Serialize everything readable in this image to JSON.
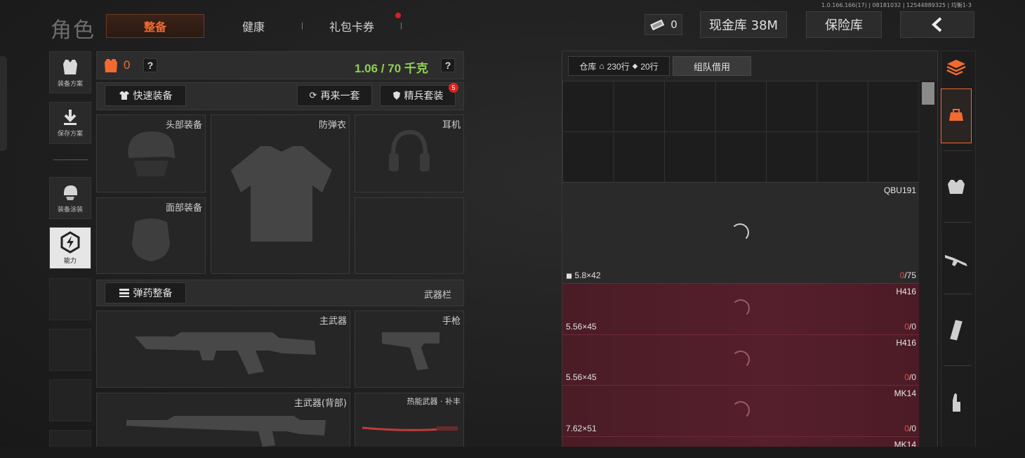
{
  "version": "1.0.166.166(17) | 08181032 | 12544889325 | 均衡1-3",
  "header": {
    "title": "角色",
    "tabs": [
      {
        "label": "整备",
        "active": true
      },
      {
        "label": "健康",
        "active": false
      },
      {
        "label": "礼包卡券",
        "active": false,
        "badge": true
      }
    ],
    "ticket_count": "0",
    "cash_label": "现金库 38M",
    "safe_label": "保险库",
    "back_icon": "chevron-left-icon"
  },
  "side_menu": [
    {
      "label": "装备方案",
      "icon": "vest-icon"
    },
    {
      "label": "保存方案",
      "icon": "download-icon"
    },
    {
      "label": "装备涂装",
      "icon": "helmet-paint-icon"
    },
    {
      "label": "能力",
      "icon": "ability-icon",
      "active": true
    }
  ],
  "equipment": {
    "armor_value": "0",
    "help_mark": "?",
    "weight": "1.06 / 70 千克",
    "quick_equip": "快速装备",
    "again_set": "再来一套",
    "elite_set": "精兵套装",
    "elite_badge": "5",
    "slots": {
      "head": "头部装备",
      "vest": "防弹衣",
      "headset": "耳机",
      "face": "面部装备"
    },
    "ammo_arrange": "弹药整备",
    "weapon_bar": "武器栏",
    "weapons": {
      "primary": "主武器",
      "pistol": "手枪",
      "primary_back": "主武器(背部)",
      "melee": "热能武器 · 补丰"
    }
  },
  "warehouse": {
    "tab_label": "仓库",
    "rows_a": "230行",
    "rows_b": "20行",
    "team_borrow": "组队借用",
    "items": [
      {
        "name": "QBU191",
        "caliber": "5.8×42",
        "count_cur": "0",
        "count_max": "/75"
      },
      {
        "name": "H416",
        "caliber": "5.56×45",
        "count_cur": "0",
        "count_max": "/0"
      },
      {
        "name": "H416",
        "caliber": "5.56×45",
        "count_cur": "0",
        "count_max": "/0"
      },
      {
        "name": "MK14",
        "caliber": "7.62×51",
        "count_cur": "0",
        "count_max": "/0"
      },
      {
        "name": "MK14"
      }
    ]
  },
  "rail": [
    "layers-icon",
    "backpack-icon",
    "armor-icon",
    "rifle-icon",
    "magazine-icon",
    "bullet-icon"
  ],
  "colors": {
    "accent": "#f26a30",
    "weight": "#8fd14f",
    "ammo_bg": "#561f2c"
  }
}
